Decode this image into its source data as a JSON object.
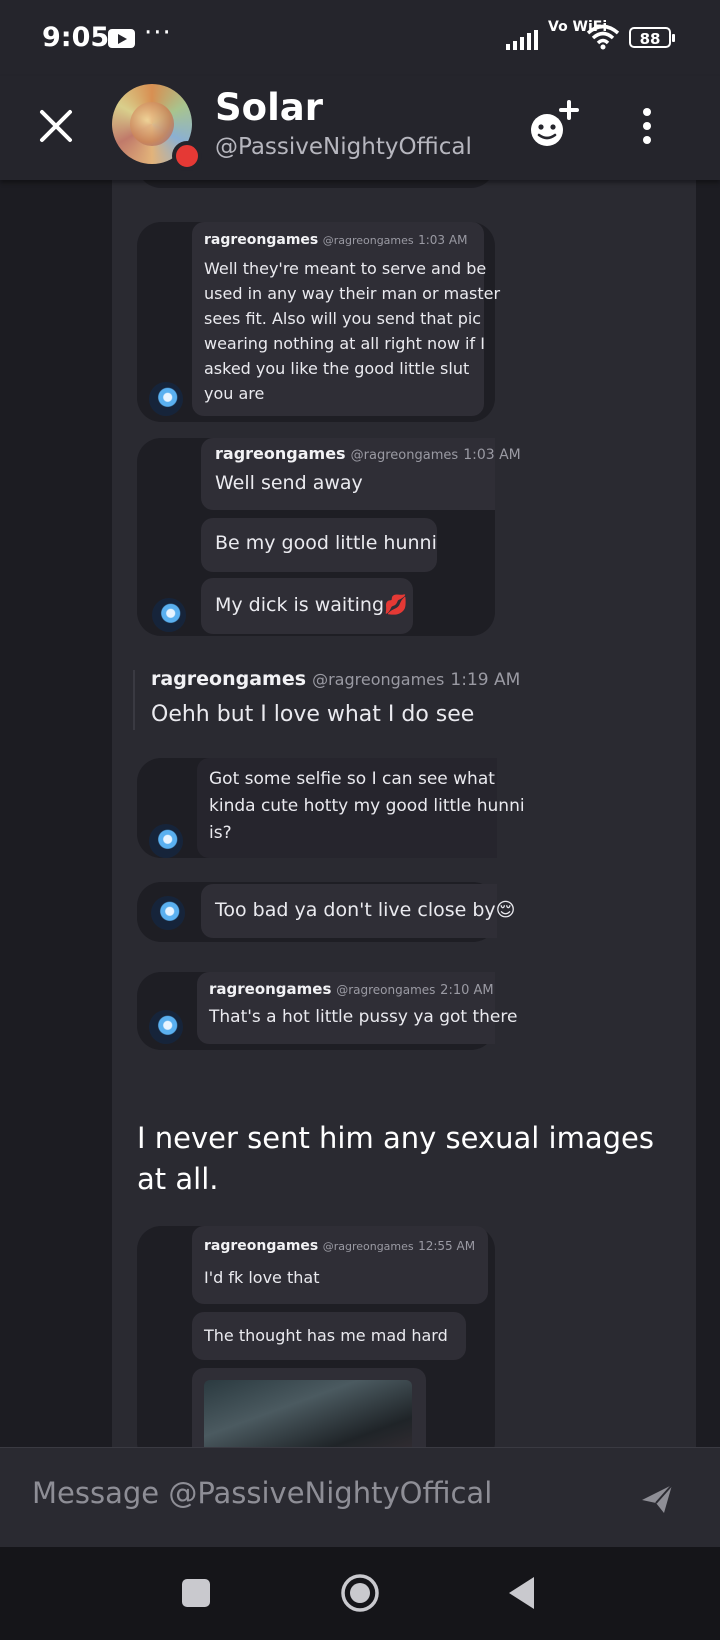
{
  "status_bar": {
    "time": "9:05",
    "more": "···",
    "network": "Vo WiFi",
    "battery": "88"
  },
  "header": {
    "name": "Solar",
    "handle": "@PassiveNightyOffical"
  },
  "messages": [
    {
      "author": "ragreongames",
      "handle": "@ragreongames",
      "time": "1:03 AM",
      "lines": [
        "Well they're meant to serve and be",
        "used in any way their man or master",
        "sees fit. Also will you send that pic",
        "wearing nothing at all right now if I",
        "asked you like the good little slut",
        "you are"
      ]
    },
    {
      "author": "ragreongames",
      "handle": "@ragreongames",
      "time": "1:03 AM",
      "texts": [
        "Well send away",
        "Be my good little hunni",
        "My dick is waiting💋"
      ]
    },
    {
      "author": "ragreongames",
      "handle": "@ragreongames",
      "time": "1:19 AM",
      "text": "Oehh but I love what I do see"
    },
    {
      "lines": [
        "Got some selfie so I can see what",
        "kinda cute hotty my good little hunni",
        "is?"
      ]
    },
    {
      "text": "Too bad ya don't live close by😌"
    },
    {
      "author": "ragreongames",
      "handle": "@ragreongames",
      "time": "2:10 AM",
      "text": "That's a hot little pussy ya got there"
    },
    {
      "author": "ragreongames",
      "handle": "@ragreongames",
      "time": "12:55 AM",
      "texts": [
        "I'd fk love that",
        "The thought has me mad hard"
      ]
    }
  ],
  "caption": "I never sent him any sexual images at all.",
  "input": {
    "placeholder": "Message @PassiveNightyOffical"
  }
}
